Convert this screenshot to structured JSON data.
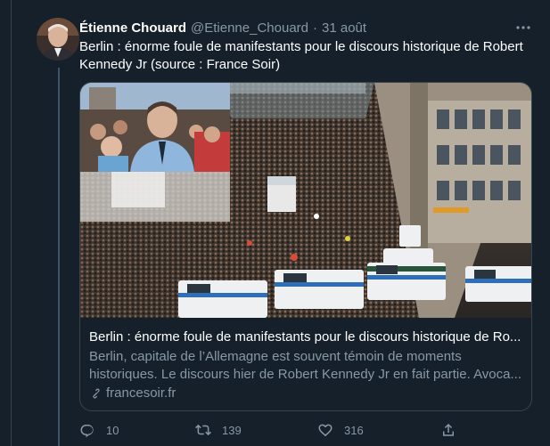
{
  "tweet": {
    "author_name": "Étienne Chouard",
    "author_handle": "@Etienne_Chouard",
    "separator": "·",
    "date": "31 août",
    "text": "Berlin : énorme foule de manifestants pour le discours historique de Robert Kennedy Jr (source : France Soir)"
  },
  "card": {
    "title": "Berlin : énorme foule de manifestants pour le discours historique de Ro...",
    "description": "Berlin, capitale de l’Allemagne est souvent témoin de moments historiques.  Le discours hier de Robert Kennedy Jr en fait partie. Avoca...",
    "domain": "francesoir.fr"
  },
  "actions": {
    "reply_count": "10",
    "retweet_count": "139",
    "like_count": "316"
  },
  "colors": {
    "background": "#15202b",
    "border": "#38444d",
    "secondary_text": "#8899a6",
    "primary_text": "#ffffff"
  },
  "icons": [
    "more-icon",
    "link-icon",
    "reply-icon",
    "retweet-icon",
    "like-icon",
    "share-icon"
  ]
}
